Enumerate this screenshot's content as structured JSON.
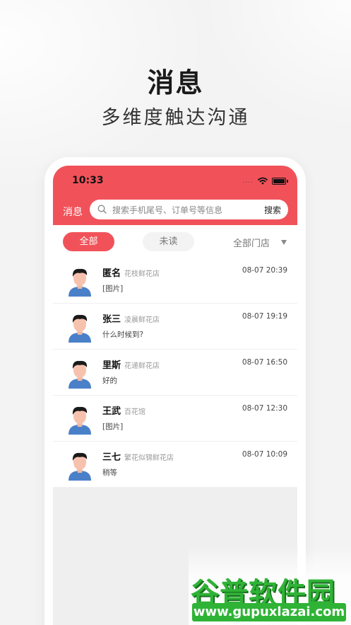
{
  "promo": {
    "title": "消息",
    "subtitle": "多维度触达沟通"
  },
  "status_bar": {
    "time": "10:33"
  },
  "header": {
    "title": "消息",
    "search_placeholder": "搜索手机尾号、订单号等信息",
    "search_button": "搜索"
  },
  "filters": {
    "all": "全部",
    "unread": "未读",
    "store": "全部门店"
  },
  "messages": [
    {
      "name": "匿名",
      "store": "花枝鲜花店",
      "time": "08-07 20:39",
      "preview": "[图片]"
    },
    {
      "name": "张三",
      "store": "凌晨鲜花店",
      "time": "08-07 19:19",
      "preview": "什么时候到?"
    },
    {
      "name": "里斯",
      "store": "花递鲜花店",
      "time": "08-07 16:50",
      "preview": "好的"
    },
    {
      "name": "王武",
      "store": "百花馆",
      "time": "08-07 12:30",
      "preview": "[图片]"
    },
    {
      "name": "三七",
      "store": "繁花似锦鲜花店",
      "time": "08-07 10:09",
      "preview": "稍等"
    }
  ],
  "watermark": {
    "logo": "谷普软件园",
    "url": "www.gupuxlazai.com"
  },
  "colors": {
    "accent": "#f1525a",
    "watermark": "#2fb336"
  },
  "icons": [
    "search-icon",
    "wifi-icon",
    "battery-icon",
    "dropdown-icon",
    "avatar"
  ]
}
